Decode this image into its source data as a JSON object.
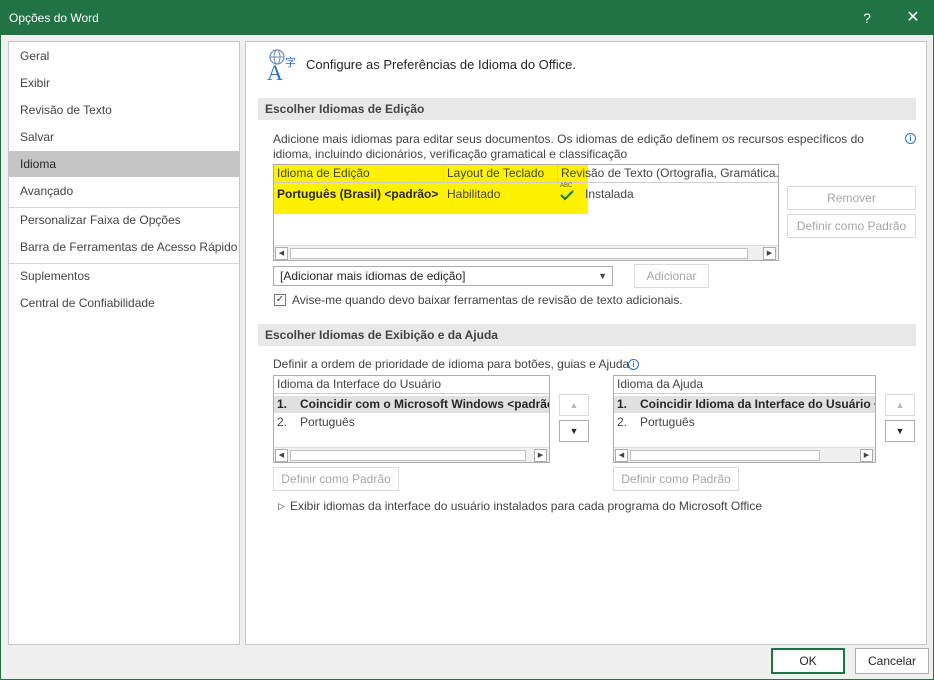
{
  "window": {
    "title": "Opções do Word"
  },
  "titlebar": {
    "help_label": "?",
    "close_label": "✕"
  },
  "sidebar": {
    "items": [
      {
        "label": "Geral"
      },
      {
        "label": "Exibir"
      },
      {
        "label": "Revisão de Texto"
      },
      {
        "label": "Salvar"
      },
      {
        "label": "Idioma"
      },
      {
        "label": "Avançado"
      },
      {
        "label": "Personalizar Faixa de Opções"
      },
      {
        "label": "Barra de Ferramentas de Acesso Rápido"
      },
      {
        "label": "Suplementos"
      },
      {
        "label": "Central de Confiabilidade"
      }
    ],
    "selected": "Idioma"
  },
  "main": {
    "header": "Configure as Preferências de Idioma do Office.",
    "editing": {
      "section_title": "Escolher Idiomas de Edição",
      "description": "Adicione mais idiomas para editar seus documentos. Os idiomas de edição definem os recursos específicos do idioma, incluindo dicionários, verificação gramatical e classificação",
      "columns": [
        "Idioma de Edição",
        "Layout de Teclado",
        "Revisão de Texto (Ortografia, Gramática..."
      ],
      "rows": [
        {
          "language": "Português (Brasil) <padrão>",
          "keyboard": "Habilitado",
          "proofing_icon_text": "ABC",
          "proofing": "Instalada"
        }
      ],
      "remove_button": "Remover",
      "set_default_button": "Definir como Padrão",
      "add_dropdown": "[Adicionar mais idiomas de edição]",
      "add_button": "Adicionar",
      "notify_checkbox_label": "Avise-me quando devo baixar ferramentas de revisão de texto adicionais.",
      "notify_checked": true
    },
    "display": {
      "section_title": "Escolher Idiomas de Exibição e da Ajuda",
      "description": "Definir a ordem de prioridade de idioma para botões, guias e Ajuda",
      "ui_list": {
        "header": "Idioma da Interface do Usuário",
        "items": [
          {
            "num": "1.",
            "label": "Coincidir com o Microsoft Windows <padrão>"
          },
          {
            "num": "2.",
            "label": "Português"
          }
        ]
      },
      "help_list": {
        "header": "Idioma da Ajuda",
        "items": [
          {
            "num": "1.",
            "label": "Coincidir Idioma da Interface do Usuário <"
          },
          {
            "num": "2.",
            "label": "Português"
          }
        ]
      },
      "set_default_button": "Definir como Padrão",
      "expander_label": "Exibir idiomas da interface do usuário instalados para cada programa do Microsoft Office"
    }
  },
  "footer": {
    "ok": "OK",
    "cancel": "Cancelar"
  },
  "colors": {
    "title_bar": "#217346",
    "highlight": "#fff200",
    "check": "#1e7b34"
  }
}
